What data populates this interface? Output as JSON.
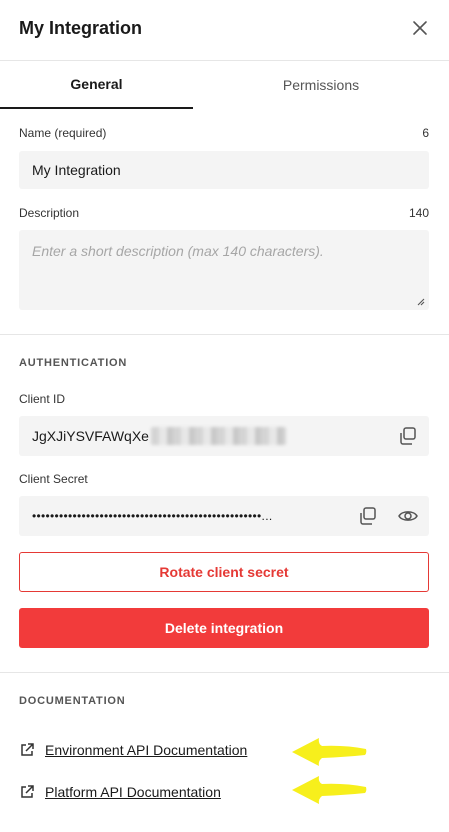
{
  "header": {
    "title": "My Integration"
  },
  "tabs": [
    {
      "label": "General",
      "active": true
    },
    {
      "label": "Permissions",
      "active": false
    }
  ],
  "general": {
    "name": {
      "label": "Name (required)",
      "count": "6",
      "value": "My Integration"
    },
    "description": {
      "label": "Description",
      "count": "140",
      "placeholder": "Enter a short description (max 140 characters)."
    }
  },
  "authentication": {
    "section_title": "AUTHENTICATION",
    "client_id": {
      "label": "Client ID",
      "value": "JgXJiYSVFAWqXe"
    },
    "client_secret": {
      "label": "Client Secret",
      "value": "•••••••••••••••••••••••••••••••••••••••••••••••••••...",
      "masked": true
    },
    "rotate_label": "Rotate client secret",
    "delete_label": "Delete integration"
  },
  "documentation": {
    "section_title": "DOCUMENTATION",
    "links": [
      {
        "label": "Environment API Documentation"
      },
      {
        "label": "Platform API Documentation"
      }
    ]
  },
  "colors": {
    "danger": "#f23b3b",
    "danger_outline": "#e53935",
    "annotation_arrow": "#f7ef1c"
  }
}
